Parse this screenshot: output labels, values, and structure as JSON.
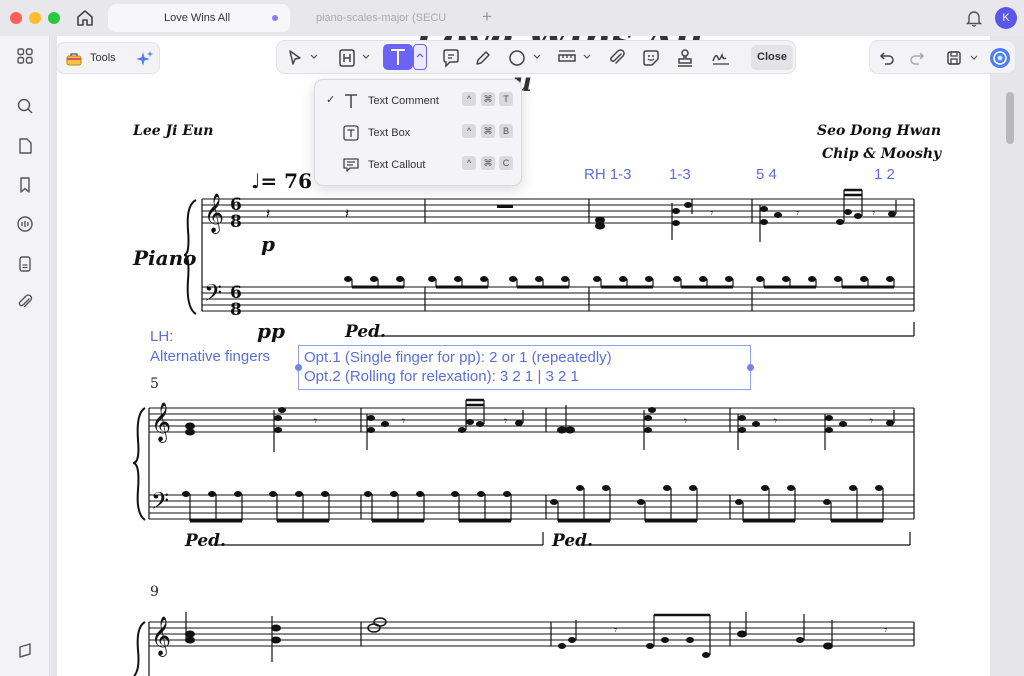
{
  "window": {
    "tabs": [
      {
        "label": "Love Wins All",
        "active": true
      },
      {
        "label": "piano-scales-major (SECU"
      }
    ],
    "avatar_initial": "K"
  },
  "left_toolbar": {
    "tools_label": "Tools"
  },
  "main_toolbar": {
    "icons": [
      "select-icon",
      "highlight-icon",
      "text-icon",
      "comment-icon",
      "pen-icon",
      "shape-icon",
      "ruler-icon",
      "attach-icon",
      "sticker-icon",
      "stamp-icon",
      "signature-icon"
    ],
    "close_label": "Close"
  },
  "text_menu": {
    "items": [
      {
        "label": "Text Comment",
        "checked": true,
        "shortcut": [
          "^",
          "⌘",
          "T"
        ]
      },
      {
        "label": "Text Box",
        "checked": false,
        "shortcut": [
          "^",
          "⌘",
          "B"
        ]
      },
      {
        "label": "Text Callout",
        "checked": false,
        "shortcut": [
          "^",
          "⌘",
          "C"
        ]
      }
    ],
    "check_glyph": "✓"
  },
  "sheet": {
    "title_partial": "Love Wins All",
    "subtitle_partial": "u",
    "composer_left": "Lee Ji Eun",
    "composer_right_1": "Seo Dong Hwan",
    "composer_right_2": "Chip & Mooshy",
    "tempo": "♩= 76",
    "instrument": "Piano",
    "dynamic_p": "p",
    "dynamic_pp": "pp",
    "ped": "Ped.",
    "measure_5": "5",
    "measure_9": "9",
    "fingering": [
      "RH 1-3",
      "1-3",
      "5 4",
      "1 2"
    ],
    "lh_note_1": "LH:",
    "lh_note_2": "Alternative fingers",
    "annotation_line_1": "Opt.1 (Single finger for pp): 2 or 1 (repeatedly)",
    "annotation_line_2": "Opt.2 (Rolling for relexation): 3 2 1 | 3 2 1"
  },
  "colors": {
    "accent": "#6b63f6",
    "annotation": "#5b6ee0"
  }
}
